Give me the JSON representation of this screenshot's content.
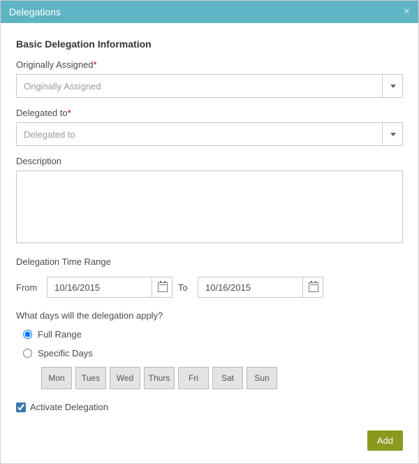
{
  "titlebar": {
    "title": "Delegations"
  },
  "heading": "Basic Delegation Information",
  "fields": {
    "originally_assigned": {
      "label": "Originally Assigned",
      "required": "*",
      "placeholder": "Originally Assigned"
    },
    "delegated_to": {
      "label": "Delegated to",
      "required": "*",
      "placeholder": "Delegated to"
    },
    "description": {
      "label": "Description"
    }
  },
  "time_range": {
    "heading": "Delegation Time Range",
    "from_label": "From",
    "to_label": "To",
    "from_value": "10/16/2015",
    "to_value": "10/16/2015"
  },
  "days": {
    "question": "What days will the delegation apply?",
    "full_range": "Full Range",
    "specific_days": "Specific Days",
    "list": [
      "Mon",
      "Tues",
      "Wed",
      "Thurs",
      "Fri",
      "Sat",
      "Sun"
    ]
  },
  "activate": {
    "label": "Activate Delegation",
    "checked": true
  },
  "footer": {
    "add": "Add"
  }
}
